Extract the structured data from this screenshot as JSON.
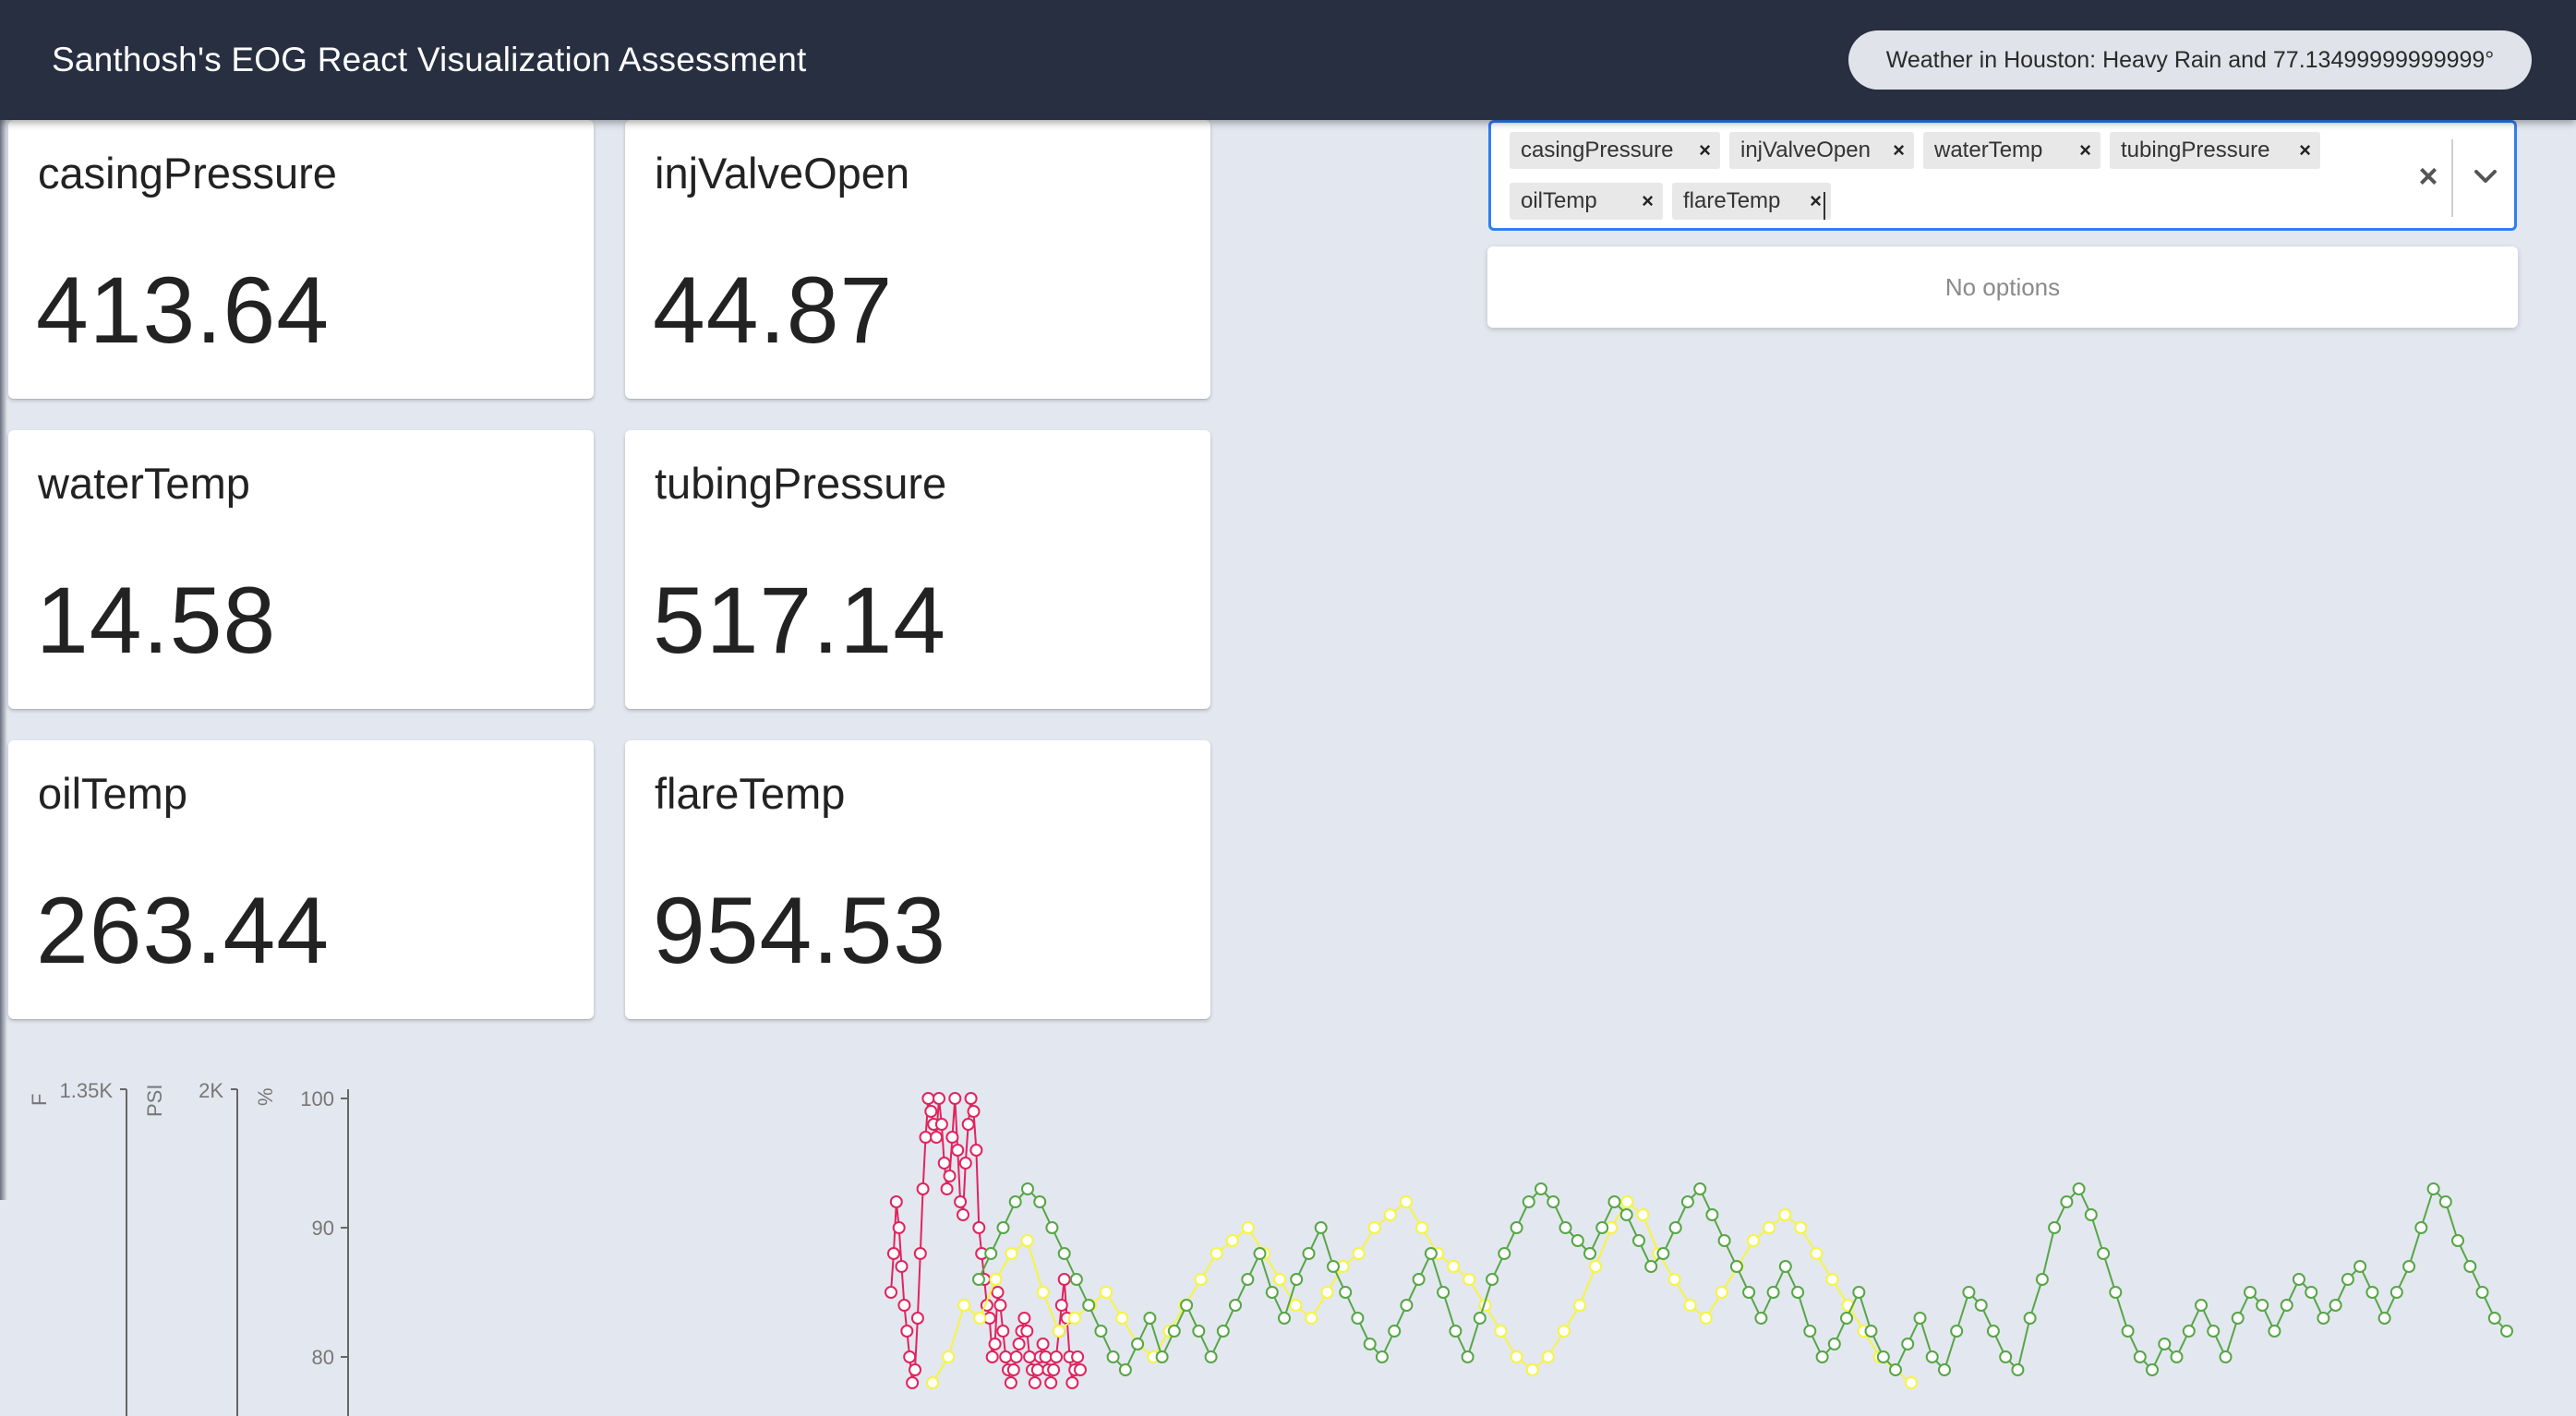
{
  "header": {
    "title": "Santhosh's EOG React Visualization Assessment",
    "weather": "Weather in Houston: Heavy Rain and 77.13499999999999°"
  },
  "metrics": [
    {
      "name": "casingPressure",
      "value": "413.64"
    },
    {
      "name": "injValveOpen",
      "value": "44.87"
    },
    {
      "name": "waterTemp",
      "value": "14.58"
    },
    {
      "name": "tubingPressure",
      "value": "517.14"
    },
    {
      "name": "oilTemp",
      "value": "263.44"
    },
    {
      "name": "flareTemp",
      "value": "954.53"
    }
  ],
  "metric_select": {
    "selected": [
      "casingPressure",
      "injValveOpen",
      "waterTemp",
      "tubingPressure",
      "oilTemp",
      "flareTemp"
    ],
    "clear_label": "×",
    "menu_empty": "No options"
  },
  "chart_data": {
    "type": "line",
    "axes": [
      {
        "unit": "F",
        "top_tick": "1.35K"
      },
      {
        "unit": "PSI",
        "top_tick": "2K"
      },
      {
        "unit": "%",
        "ticks": [
          "100",
          "90",
          "80"
        ],
        "ylim": [
          76,
          100
        ]
      }
    ],
    "series": [
      {
        "color": "#e0245e",
        "values": [
          85,
          88,
          92,
          90,
          87,
          84,
          82,
          80,
          78,
          79,
          83,
          88,
          93,
          97,
          100,
          99,
          98,
          97,
          100,
          98,
          95,
          93,
          94,
          97,
          100,
          96,
          92,
          91,
          95,
          98,
          100,
          99,
          96,
          90,
          88,
          86,
          84,
          83,
          80,
          81,
          85,
          84,
          82,
          80,
          79,
          78,
          79,
          80,
          81,
          82,
          83,
          82,
          80,
          79,
          78,
          79,
          80,
          81,
          80,
          79,
          78,
          79,
          80,
          82,
          84,
          86,
          83,
          80,
          78,
          79,
          80,
          79
        ]
      },
      {
        "color": "#f5f542",
        "values": [
          78,
          80,
          84,
          83,
          86,
          88,
          89,
          85,
          82,
          83,
          84,
          85,
          83,
          81,
          80,
          82,
          84,
          86,
          88,
          89,
          90,
          88,
          86,
          84,
          83,
          85,
          87,
          88,
          90,
          91,
          92,
          90,
          88,
          87,
          86,
          84,
          82,
          80,
          79,
          80,
          82,
          84,
          87,
          90,
          92,
          91,
          88,
          86,
          84,
          83,
          85,
          87,
          89,
          90,
          91,
          90,
          88,
          86,
          84,
          82,
          80,
          79,
          78
        ]
      },
      {
        "color": "#56a646",
        "values": [
          86,
          88,
          90,
          92,
          93,
          92,
          90,
          88,
          86,
          84,
          82,
          80,
          79,
          81,
          83,
          80,
          82,
          84,
          82,
          80,
          82,
          84,
          86,
          88,
          85,
          83,
          86,
          88,
          90,
          87,
          85,
          83,
          81,
          80,
          82,
          84,
          86,
          88,
          85,
          82,
          80,
          83,
          86,
          88,
          90,
          92,
          93,
          92,
          90,
          89,
          88,
          90,
          92,
          91,
          89,
          87,
          88,
          90,
          92,
          93,
          91,
          89,
          87,
          85,
          83,
          85,
          87,
          85,
          82,
          80,
          81,
          83,
          85,
          82,
          80,
          79,
          81,
          83,
          80,
          79,
          82,
          85,
          84,
          82,
          80,
          79,
          83,
          86,
          90,
          92,
          93,
          91,
          88,
          85,
          82,
          80,
          79,
          81,
          80,
          82,
          84,
          82,
          80,
          83,
          85,
          84,
          82,
          84,
          86,
          85,
          83,
          84,
          86,
          87,
          85,
          83,
          85,
          87,
          90,
          93,
          92,
          89,
          87,
          85,
          83,
          82
        ]
      }
    ]
  }
}
